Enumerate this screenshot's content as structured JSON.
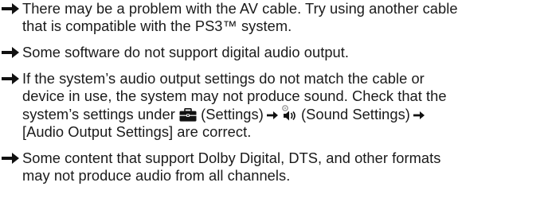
{
  "items": [
    {
      "lines": [
        "There may be a problem with the AV cable. Try using another cable",
        "that is compatible with the PS3™ system."
      ]
    },
    {
      "lines": [
        "Some software do not support digital audio output."
      ]
    },
    {
      "line1": "If the system’s audio output settings do not match the cable or",
      "line2": "device in use, the system may not produce sound. Check that the",
      "line3_prefix": "system’s settings under ",
      "settings_label": " (Settings)",
      "sound_settings_label": " (Sound Settings)",
      "line4": "[Audio Output Settings] are correct.",
      "icons": [
        "toolbox-icon",
        "speaker-settings-icon",
        "small-right-arrow-icon"
      ]
    },
    {
      "lines": [
        "Some content that support Dolby Digital, DTS, and other formats",
        "may not produce audio from all channels."
      ]
    }
  ],
  "bullet_icon": "right-arrow-icon",
  "colors": {
    "text": "#1a1a1a",
    "arrow": "#111111"
  }
}
